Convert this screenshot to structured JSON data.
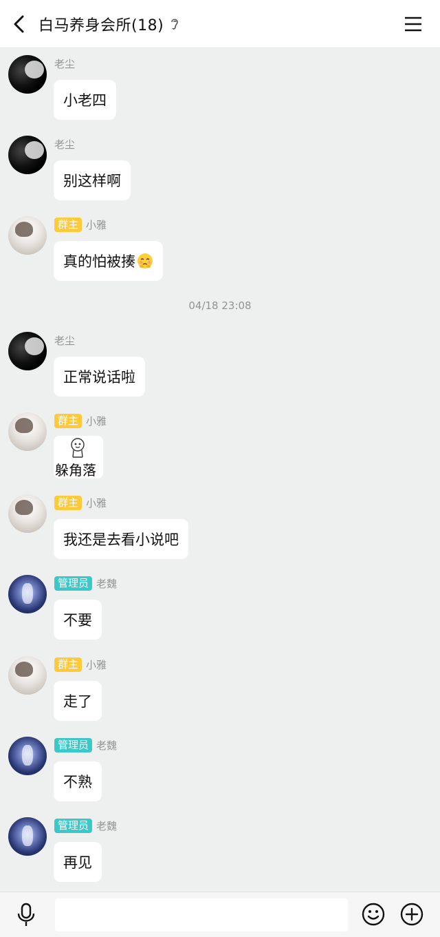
{
  "header": {
    "title": "白马养身会所(18)",
    "back_icon": "chevron-left-icon",
    "ear_icon": "ear-icon",
    "menu_icon": "hamburger-menu-icon"
  },
  "messages": [
    {
      "sender": "老尘",
      "badge": "",
      "text": "小老四"
    },
    {
      "sender": "老尘",
      "badge": "",
      "text": "别这样啊"
    },
    {
      "sender": "小雅",
      "badge": "群主",
      "text": "真的怕被揍",
      "emoji": "shy-face-emoji"
    },
    {
      "sender": "老尘",
      "badge": "",
      "text": "正常说话啦"
    },
    {
      "sender": "小雅",
      "badge": "群主",
      "sticker_text": "躲角落"
    },
    {
      "sender": "小雅",
      "badge": "群主",
      "text": "我还是去看小说吧"
    },
    {
      "sender": "老魏",
      "badge": "管理员",
      "text": "不要"
    },
    {
      "sender": "小雅",
      "badge": "群主",
      "text": "走了"
    },
    {
      "sender": "老魏",
      "badge": "管理员",
      "text": "不熟"
    },
    {
      "sender": "老魏",
      "badge": "管理员",
      "text": "再见"
    }
  ],
  "timestamp": "04/18 23:08",
  "input": {
    "value": "",
    "placeholder": ""
  },
  "toolbar": {
    "mic_icon": "microphone-icon",
    "emoji_icon": "smiley-icon",
    "plus_icon": "plus-circle-icon"
  },
  "colors": {
    "background": "#edf0ee",
    "owner_badge": "#ffc93c",
    "admin_badge": "#3cc7c9"
  }
}
